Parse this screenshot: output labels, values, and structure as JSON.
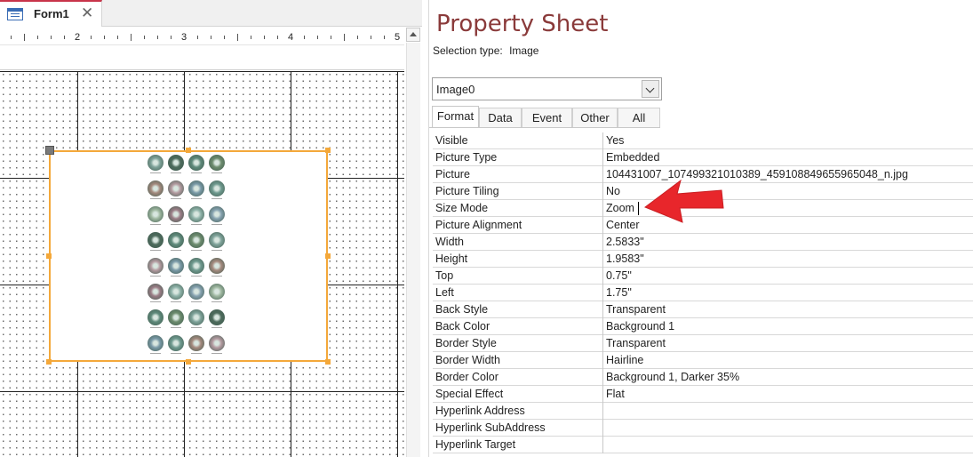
{
  "document": {
    "tab_title": "Form1",
    "close_glyph": "✕"
  },
  "ruler": {
    "labels": [
      "2",
      "3",
      "4",
      "5"
    ]
  },
  "property_sheet": {
    "title": "Property Sheet",
    "selection_type_label": "Selection type:",
    "selection_type_value": "Image",
    "object_selector_value": "Image0",
    "tabs": [
      {
        "label": "Format",
        "active": true
      },
      {
        "label": "Data",
        "active": false
      },
      {
        "label": "Event",
        "active": false
      },
      {
        "label": "Other",
        "active": false
      },
      {
        "label": "All",
        "active": false
      }
    ],
    "rows": [
      {
        "name": "Visible",
        "value": "Yes"
      },
      {
        "name": "Picture Type",
        "value": "Embedded"
      },
      {
        "name": "Picture",
        "value": "104431007_107499321010389_459108849655965048_n.jpg"
      },
      {
        "name": "Picture Tiling",
        "value": "No"
      },
      {
        "name": "Size Mode",
        "value": "Zoom"
      },
      {
        "name": "Picture Alignment",
        "value": "Center"
      },
      {
        "name": "Width",
        "value": "2.5833\""
      },
      {
        "name": "Height",
        "value": "1.9583\""
      },
      {
        "name": "Top",
        "value": "0.75\""
      },
      {
        "name": "Left",
        "value": "1.75\""
      },
      {
        "name": "Back Style",
        "value": "Transparent"
      },
      {
        "name": "Back Color",
        "value": "Background 1"
      },
      {
        "name": "Border Style",
        "value": "Transparent"
      },
      {
        "name": "Border Width",
        "value": "Hairline"
      },
      {
        "name": "Border Color",
        "value": "Background 1, Darker 35%"
      },
      {
        "name": "Special Effect",
        "value": "Flat"
      },
      {
        "name": "Hyperlink Address",
        "value": ""
      },
      {
        "name": "Hyperlink SubAddress",
        "value": ""
      },
      {
        "name": "Hyperlink Target",
        "value": ""
      }
    ]
  },
  "colors": {
    "selection_border": "#f4a83a",
    "title_color": "#8a3a3a",
    "annotation_arrow": "#e8262b",
    "tab_accent": "#c8344a"
  },
  "icons": {
    "form_tab": "form-icon",
    "close": "close-icon",
    "dropdown": "chevron-down-icon",
    "scroll_up": "scroll-up-icon"
  }
}
